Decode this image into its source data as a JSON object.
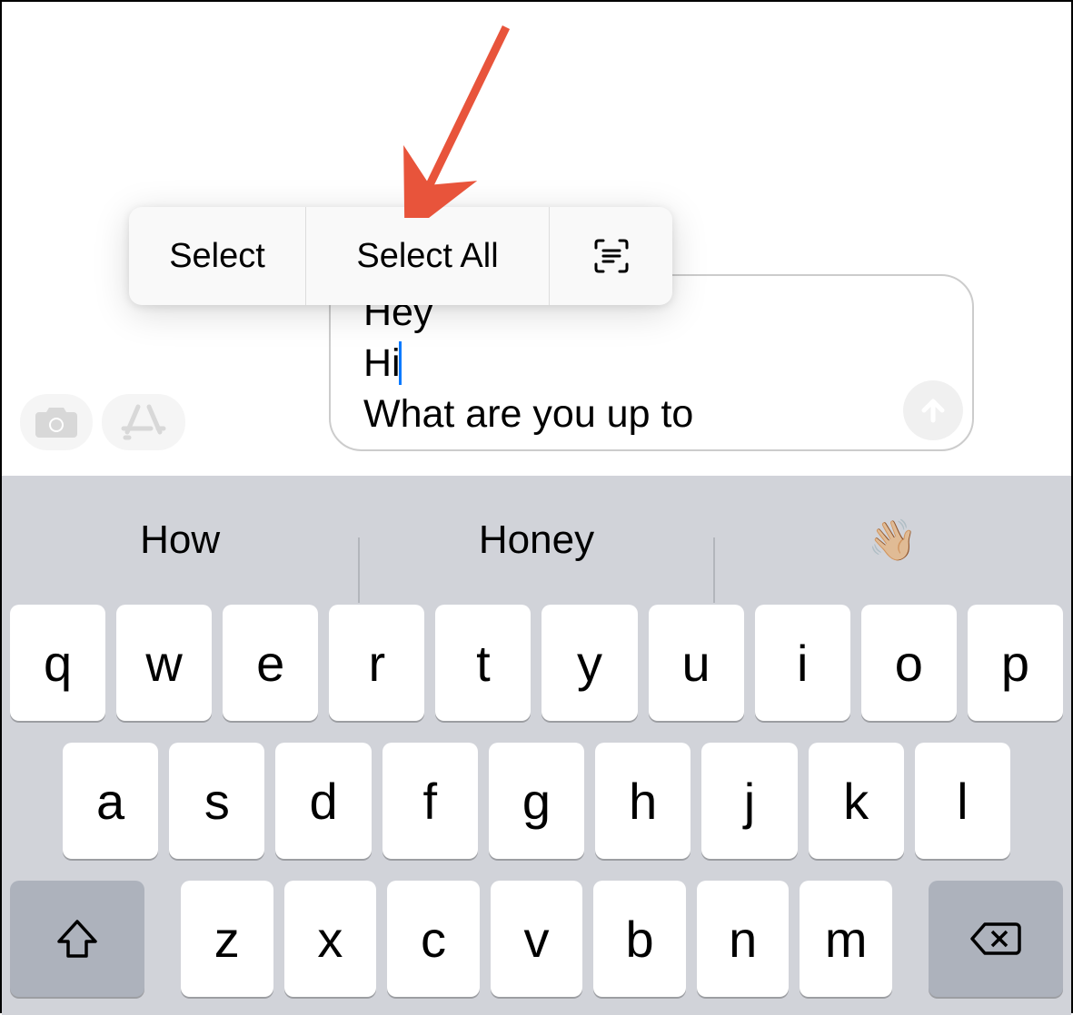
{
  "context_menu": {
    "select": "Select",
    "select_all": "Select All"
  },
  "text_input": {
    "line1": "Hey",
    "line2": "Hi",
    "line3": "What are you up to"
  },
  "suggestions": [
    "How",
    "Honey",
    "👋🏼"
  ],
  "keyboard": {
    "row1": [
      "q",
      "w",
      "e",
      "r",
      "t",
      "y",
      "u",
      "i",
      "o",
      "p"
    ],
    "row2": [
      "a",
      "s",
      "d",
      "f",
      "g",
      "h",
      "j",
      "k",
      "l"
    ],
    "row3": [
      "z",
      "x",
      "c",
      "v",
      "b",
      "n",
      "m"
    ]
  }
}
